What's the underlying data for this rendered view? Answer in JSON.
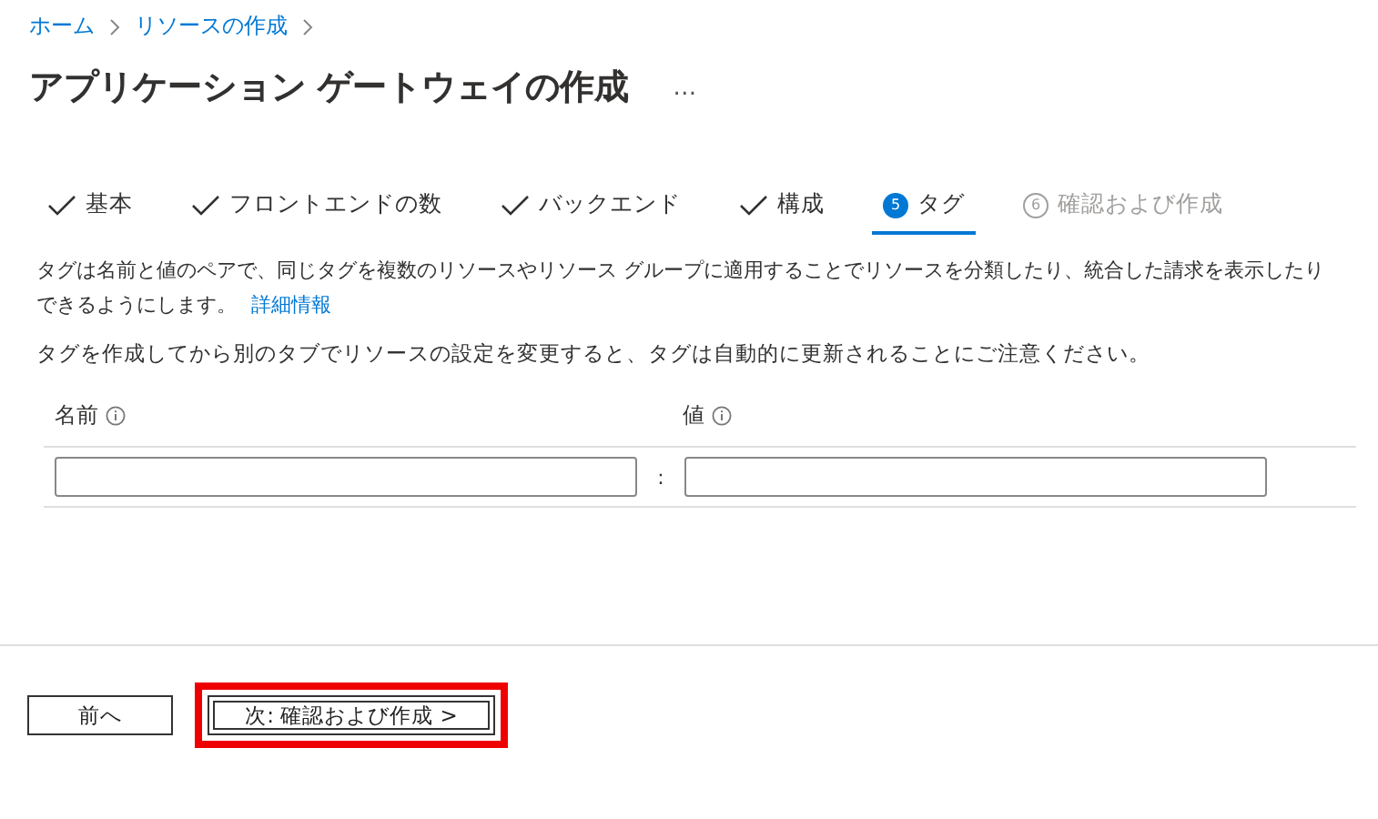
{
  "breadcrumb": [
    "ホーム",
    "リソースの作成"
  ],
  "title": "アプリケーション ゲートウェイの作成",
  "more": "…",
  "steps": [
    {
      "kind": "done",
      "label": "基本",
      "selected": false
    },
    {
      "kind": "done",
      "label": "フロントエンドの数",
      "selected": false
    },
    {
      "kind": "done",
      "label": "バックエンド",
      "selected": false
    },
    {
      "kind": "done",
      "label": "構成",
      "selected": false
    },
    {
      "kind": "current",
      "number": "5",
      "label": "タグ",
      "selected": true
    },
    {
      "kind": "pending",
      "number": "6",
      "label": "確認および作成",
      "selected": false
    }
  ],
  "description": "タグは名前と値のペアで、同じタグを複数のリソースやリソース グループに適用することでリソースを分類したり、統合した請求を表示したりできるようにします。",
  "learn_more": "詳細情報",
  "note": "タグを作成してから別のタブでリソースの設定を変更すると、タグは自動的に更新されることにご注意ください。",
  "table": {
    "columns": [
      "名前",
      "値"
    ],
    "separator": ":"
  },
  "buttons": [
    {
      "label": "前へ",
      "highlighted": false
    },
    {
      "label": "次: 確認および作成 >",
      "highlighted": true
    }
  ]
}
